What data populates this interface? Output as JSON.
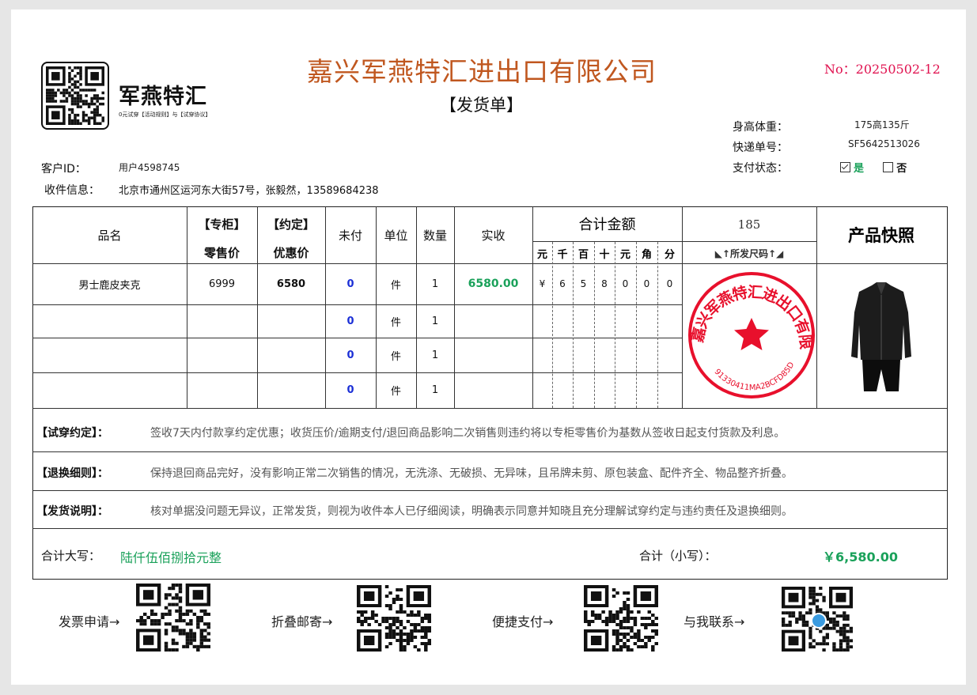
{
  "brand": {
    "name": "军燕特汇",
    "tagline": "0元试穿【活动规则】与【试穿协议】"
  },
  "company": "嘉兴军燕特汇进出口有限公司",
  "doc_title": "【发货单】",
  "doc_no": "No：20250502-12",
  "info": {
    "height_weight_label": "身高体重：",
    "height_weight": "175高135斤",
    "tracking_label": "快递单号：",
    "tracking": "SF5642513026",
    "pay_label": "支付状态：",
    "pay_yes": "是",
    "pay_no": "否",
    "customer_label": "客户ID：",
    "customer": "用户4598745",
    "address_label": "收件信息：",
    "address": "北京市通州区运河东大街57号，张毅然，13589684238"
  },
  "table": {
    "headers": {
      "name": "品名",
      "retail_top": "【专柜】",
      "retail_bot": "零售价",
      "promo_top": "【约定】",
      "promo_bot": "优惠价",
      "unpaid": "未付",
      "unit": "单位",
      "qty": "数量",
      "received": "实收",
      "total": "合计金额",
      "digits": [
        "元",
        "千",
        "百",
        "十",
        "元",
        "角",
        "分"
      ],
      "size_value": "185",
      "size_label": "◣↑所发尺码↑◢",
      "photo": "产品快照"
    },
    "rows": [
      {
        "name": "男士鹿皮夹克",
        "retail": "6999",
        "promo": "6580",
        "unpaid": "0",
        "unit": "件",
        "qty": "1",
        "received": "6580.00",
        "digits": [
          "¥",
          "6",
          "5",
          "8",
          "0",
          "0",
          "0"
        ]
      },
      {
        "name": "",
        "retail": "",
        "promo": "",
        "unpaid": "0",
        "unit": "件",
        "qty": "1",
        "received": "",
        "digits": [
          "",
          "",
          "",
          "",
          "",
          "",
          ""
        ]
      },
      {
        "name": "",
        "retail": "",
        "promo": "",
        "unpaid": "0",
        "unit": "件",
        "qty": "1",
        "received": "",
        "digits": [
          "",
          "",
          "",
          "",
          "",
          "",
          ""
        ]
      },
      {
        "name": "",
        "retail": "",
        "promo": "",
        "unpaid": "0",
        "unit": "件",
        "qty": "1",
        "received": "",
        "digits": [
          "",
          "",
          "",
          "",
          "",
          "",
          ""
        ]
      }
    ]
  },
  "stamp": {
    "text": "嘉兴军燕特汇进出口有限公司",
    "code": "91330411MA2BCFD85D",
    "color": "#e8102c"
  },
  "terms": [
    {
      "label": "【试穿约定】：",
      "text": "签收7天内付款享约定优惠；收货压价/逾期支付/退回商品影响二次销售则违约将以专柜零售价为基数从签收日起支付货款及利息。"
    },
    {
      "label": "【退换细则】：",
      "text": "保持退回商品完好，没有影响正常二次销售的情况，无洗涤、无破损、无异味，且吊牌未剪、原包装盒、配件齐全、物品整齐折叠。"
    },
    {
      "label": "【发货说明】：",
      "text": "核对单据没问题无异议，正常发货，则视为收件本人已仔细阅读，明确表示同意并知晓且充分理解试穿约定与违约责任及退换细则。"
    }
  ],
  "totals": {
    "upper_label": "合计大写：",
    "upper": "陆仟伍佰捌拾元整",
    "lower_label": "合计（小写）：",
    "lower": "￥6,580.00"
  },
  "qr_links": [
    "发票申请→",
    "折叠邮寄→",
    "便捷支付→",
    "与我联系→"
  ]
}
